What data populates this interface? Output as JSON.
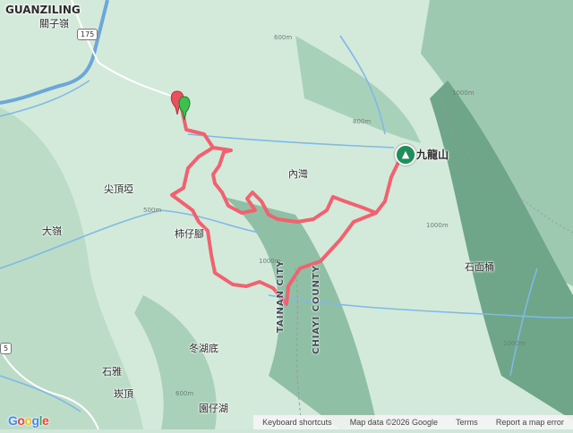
{
  "map": {
    "places": {
      "guanziling_en": "GUANZILING",
      "guanziling_zh": "關子嶺",
      "jianding_jian": "尖頂埡",
      "da_ling": "大嶺",
      "shi_zi_jiao": "柿仔腳",
      "nei_wan": "內灣",
      "jiu_long_shan": "九龍山",
      "shi_mian_tong": "石面桶",
      "dong_hu_di": "冬湖底",
      "shi_ya": "石雅",
      "jiao_ding": "崁頂",
      "bottom_label": "園仔湖"
    },
    "county": {
      "tainan": "TAINAN CITY",
      "chiayi": "CHIAYI COUNTY"
    },
    "road": "175",
    "road_left": "5",
    "elevations": {
      "e1": "600m",
      "e2": "1000m",
      "e3": "800m",
      "e4": "500m",
      "e5": "1000m",
      "e6": "1000m",
      "e7": "600m",
      "e8": "1000m"
    },
    "colors": {
      "track": "#f26170",
      "water": "#7fb9e6",
      "terrain_light": "#d7ecdd",
      "terrain_dark": "#5e9a78"
    }
  },
  "footer": {
    "shortcuts": "Keyboard shortcuts",
    "map_data": "Map data ©2026 Google",
    "terms": "Terms",
    "report": "Report a map error"
  },
  "logo": {
    "letters": [
      "G",
      "o",
      "o",
      "g",
      "l",
      "e"
    ]
  }
}
